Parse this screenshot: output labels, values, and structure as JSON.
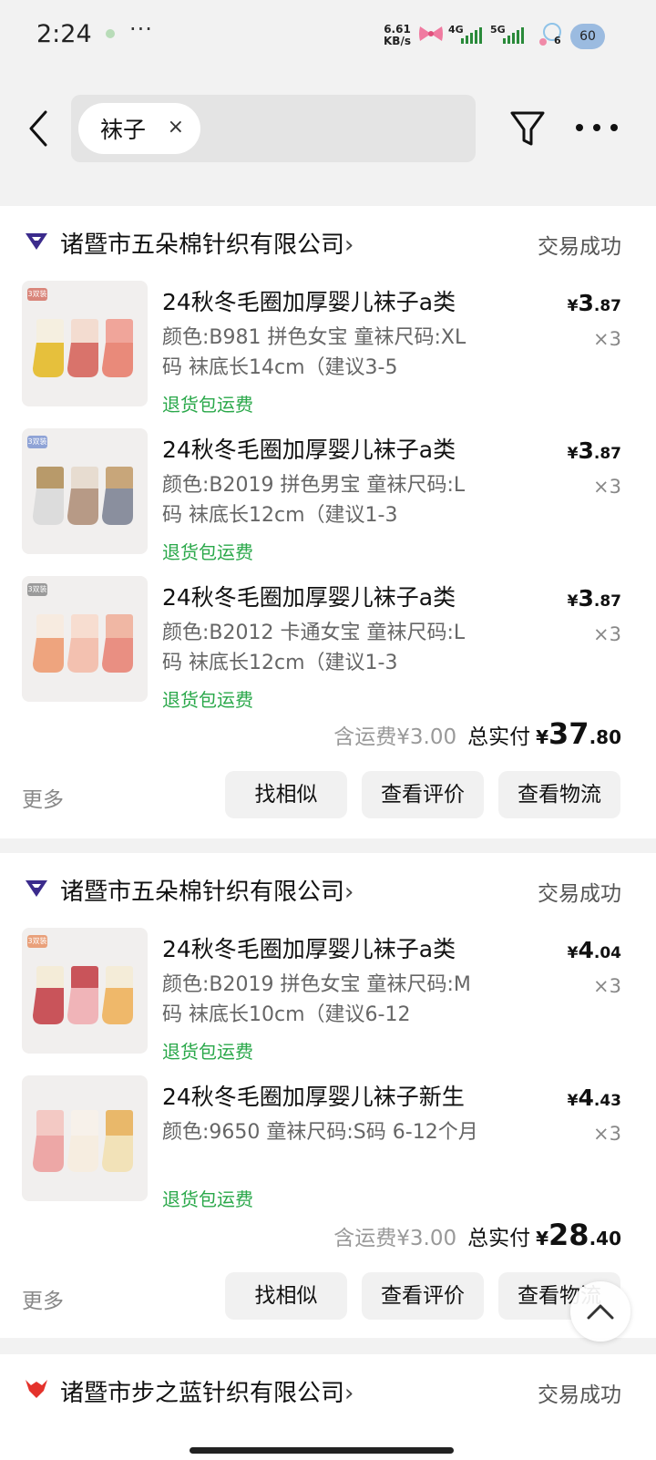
{
  "status_bar": {
    "time": "2:24",
    "more": "···",
    "net_speed_value": "6.61",
    "net_speed_unit": "KB/s",
    "net_type_1": "4G",
    "net_type_2": "5G",
    "extra_badge": "6",
    "battery": "60"
  },
  "search": {
    "chip_label": "袜子",
    "chip_close": "×"
  },
  "orders": [
    {
      "shop_name": "诸暨市五朵棉针织有限公司",
      "chevron": "›",
      "status": "交易成功",
      "items": [
        {
          "title": "24秋冬毛圈加厚婴儿袜子a类",
          "spec": "颜色:B981 拼色女宝 童袜尺码:XL码 袜底长14cm（建议3-5",
          "tag": "退货包运费",
          "price_symbol": "¥",
          "price_int": "3",
          "price_dec": ".87",
          "qty": "×3",
          "badge": "3双装",
          "badge_color": "#d9857a",
          "sock_colors": [
            "#e6c03c",
            "#d9736b",
            "#e98a7a"
          ],
          "cuff_colors": [
            "#f5efe0",
            "#f3dcd0",
            "#f0a59a"
          ]
        },
        {
          "title": "24秋冬毛圈加厚婴儿袜子a类",
          "spec": "颜色:B2019 拼色男宝 童袜尺码:L码 袜底长12cm（建议1-3",
          "tag": "退货包运费",
          "price_symbol": "¥",
          "price_int": "3",
          "price_dec": ".87",
          "qty": "×3",
          "badge": "3双装",
          "badge_color": "#8fa3d6",
          "sock_colors": [
            "#dcdcdc",
            "#b79a86",
            "#8a8f9e"
          ],
          "cuff_colors": [
            "#b89a6a",
            "#e7dcd0",
            "#c8a67a"
          ]
        },
        {
          "title": "24秋冬毛圈加厚婴儿袜子a类",
          "spec": "颜色:B2012 卡通女宝 童袜尺码:L码 袜底长12cm（建议1-3",
          "tag": "退货包运费",
          "price_symbol": "¥",
          "price_int": "3",
          "price_dec": ".87",
          "qty": "×3",
          "badge": "3双装",
          "badge_color": "#9a9a9a",
          "sock_colors": [
            "#eea47e",
            "#f3c1b0",
            "#e98f82"
          ],
          "cuff_colors": [
            "#f7ebe0",
            "#f7ddd0",
            "#f0b7a4"
          ]
        }
      ],
      "total": {
        "shipping": "含运费¥3.00",
        "label": "总实付",
        "symbol": "¥",
        "int": "37",
        "dec": ".80"
      },
      "more_label": "更多",
      "actions": [
        "找相似",
        "查看评价",
        "查看物流"
      ]
    },
    {
      "shop_name": "诸暨市五朵棉针织有限公司",
      "chevron": "›",
      "status": "交易成功",
      "items": [
        {
          "title": "24秋冬毛圈加厚婴儿袜子a类",
          "spec": "颜色:B2019 拼色女宝 童袜尺码:M码 袜底长10cm（建议6-12",
          "tag": "退货包运费",
          "price_symbol": "¥",
          "price_int": "4",
          "price_dec": ".04",
          "qty": "×3",
          "badge": "3双装",
          "badge_color": "#e9a07a",
          "sock_colors": [
            "#c9545a",
            "#f0b4b8",
            "#efb86a"
          ],
          "cuff_colors": [
            "#f4ecd8",
            "#c9545a",
            "#f4ecd8"
          ]
        },
        {
          "title": "24秋冬毛圈加厚婴儿袜子新生",
          "spec": "颜色:9650 童袜尺码:S码 6-12个月",
          "tag": "退货包运费",
          "price_symbol": "¥",
          "price_int": "4",
          "price_dec": ".43",
          "qty": "×3",
          "badge": "",
          "badge_color": "#ffffff",
          "sock_colors": [
            "#eda7a6",
            "#f6ede0",
            "#f2e2b8"
          ],
          "cuff_colors": [
            "#f3c9c4",
            "#f7f1ea",
            "#e9b86a"
          ]
        }
      ],
      "total": {
        "shipping": "含运费¥3.00",
        "label": "总实付",
        "symbol": "¥",
        "int": "28",
        "dec": ".40"
      },
      "more_label": "更多",
      "actions": [
        "找相似",
        "查看评价",
        "查看物流"
      ]
    },
    {
      "shop_name": "诸暨市步之蓝针织有限公司",
      "chevron": "›",
      "status": "交易成功",
      "items": [],
      "actions": []
    }
  ],
  "colors": {
    "shop_icon_1": "#3b2b8c",
    "shop_icon_2": "#e4322b",
    "return_tag": "#2aa84a"
  }
}
